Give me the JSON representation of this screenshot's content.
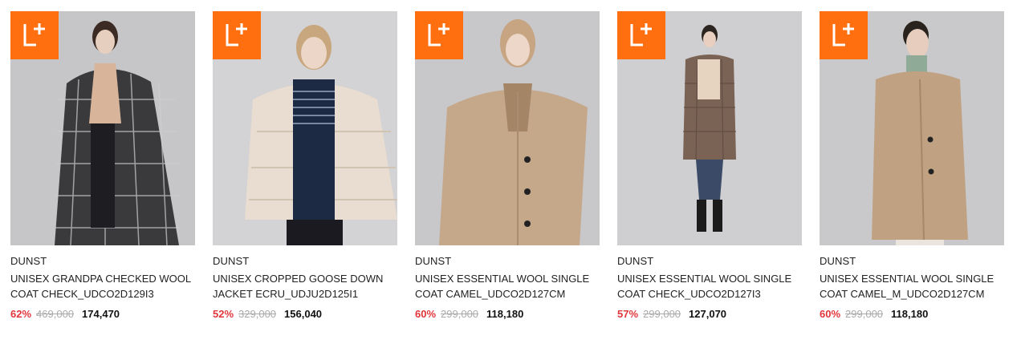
{
  "badge": {
    "label": "L+",
    "icon": "lplus-badge-icon",
    "color": "#ff6f0f"
  },
  "colors": {
    "discount": "#e0363c",
    "original_price": "#aaaaaa"
  },
  "products": [
    {
      "brand": "DUNST",
      "name": "UNISEX GRANDPA CHECKED WOOL COAT CHECK_UDCO2D129I3",
      "discount": "62%",
      "original_price": "469,000",
      "price": "174,470",
      "image": {
        "bg": "#c6c6c9",
        "coat": "#3a3a3c",
        "pattern": "check"
      }
    },
    {
      "brand": "DUNST",
      "name": "UNISEX CROPPED GOOSE DOWN JACKET ECRU_UDJU2D125I1",
      "discount": "52%",
      "original_price": "329,000",
      "price": "156,040",
      "image": {
        "bg": "#d3d2d4",
        "coat": "#e8ddd0",
        "pattern": "puffer"
      }
    },
    {
      "brand": "DUNST",
      "name": "UNISEX ESSENTIAL WOOL SINGLE COAT CAMEL_UDCO2D127CM",
      "discount": "60%",
      "original_price": "299,000",
      "price": "118,180",
      "image": {
        "bg": "#c8c7ca",
        "coat": "#c5a88a",
        "pattern": "plain"
      }
    },
    {
      "brand": "DUNST",
      "name": "UNISEX ESSENTIAL WOOL SINGLE COAT CHECK_UDCO2D127I3",
      "discount": "57%",
      "original_price": "299,000",
      "price": "127,070",
      "image": {
        "bg": "#cfced0",
        "coat": "#7a6255",
        "pattern": "fullbody"
      }
    },
    {
      "brand": "DUNST",
      "name": "UNISEX ESSENTIAL WOOL SINGLE COAT CAMEL_M_UDCO2D127CM",
      "discount": "60%",
      "original_price": "299,000",
      "price": "118,180",
      "image": {
        "bg": "#c9c8cb",
        "coat": "#c0a283",
        "pattern": "plain"
      }
    }
  ]
}
